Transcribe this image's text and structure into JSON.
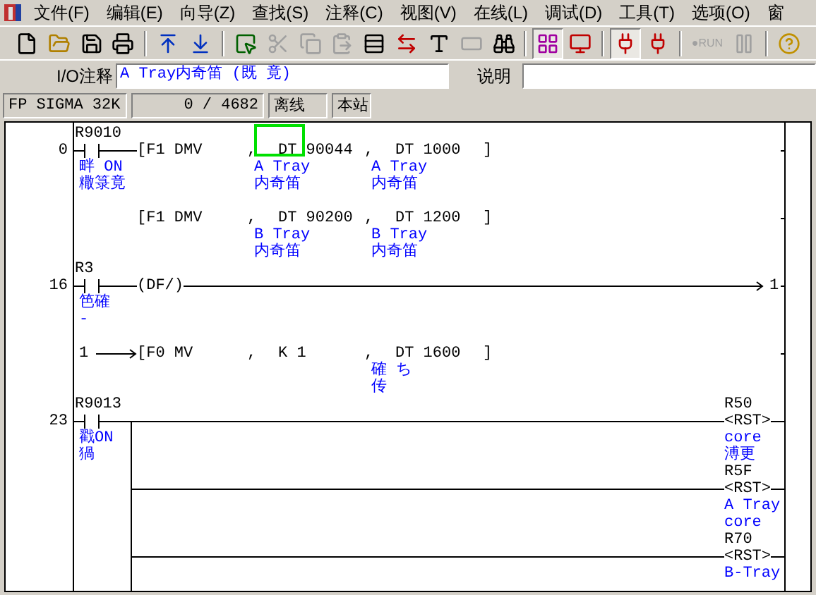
{
  "menu": [
    "文件(F)",
    "编辑(E)",
    "向导(Z)",
    "查找(S)",
    "注释(C)",
    "视图(V)",
    "在线(L)",
    "调试(D)",
    "工具(T)",
    "选项(O)",
    "窗"
  ],
  "toolbar": [
    {
      "kind": "new",
      "disabled": false,
      "pressed": false
    },
    {
      "kind": "open",
      "disabled": false,
      "pressed": false
    },
    {
      "kind": "save",
      "disabled": false,
      "pressed": false
    },
    {
      "kind": "print",
      "disabled": false,
      "pressed": false
    },
    {
      "kind": "separator"
    },
    {
      "kind": "upload",
      "disabled": false,
      "pressed": false
    },
    {
      "kind": "download",
      "disabled": false,
      "pressed": false
    },
    {
      "kind": "separator"
    },
    {
      "kind": "select",
      "disabled": false,
      "pressed": false
    },
    {
      "kind": "cut",
      "disabled": true,
      "pressed": false
    },
    {
      "kind": "copy",
      "disabled": true,
      "pressed": false
    },
    {
      "kind": "paste",
      "disabled": true,
      "pressed": false
    },
    {
      "kind": "grid",
      "disabled": false,
      "pressed": false
    },
    {
      "kind": "swap",
      "disabled": false,
      "pressed": false
    },
    {
      "kind": "text",
      "disabled": false,
      "pressed": false
    },
    {
      "kind": "bar",
      "disabled": true,
      "pressed": false
    },
    {
      "kind": "find",
      "disabled": false,
      "pressed": false
    },
    {
      "kind": "separator"
    },
    {
      "kind": "ladder",
      "disabled": false,
      "pressed": true
    },
    {
      "kind": "monitor",
      "disabled": false,
      "pressed": false
    },
    {
      "kind": "separator"
    },
    {
      "kind": "plug",
      "disabled": false,
      "pressed": true
    },
    {
      "kind": "plug",
      "disabled": false,
      "pressed": false
    },
    {
      "kind": "separator"
    },
    {
      "kind": "run",
      "label": "●RUN",
      "disabled": true,
      "pressed": false
    },
    {
      "kind": "pause",
      "disabled": true,
      "pressed": false
    },
    {
      "kind": "separator"
    },
    {
      "kind": "help",
      "disabled": false,
      "pressed": false
    }
  ],
  "io_comment": {
    "label": "I/O注释",
    "value": "A Tray内奇笛  (既  竟)"
  },
  "description": {
    "label": "说明"
  },
  "status_bar": [
    "FP SIGMA 32K",
    "0 /  4682",
    "离线",
    "本站"
  ],
  "rungs": [
    {
      "kind": "function",
      "step": "0",
      "contact": "R9010",
      "contact_comment": [
        "畔  ON",
        "糤箓竟"
      ],
      "lines": [
        {
          "instruction": "[F1 DMV",
          "operands": [
            {
              "separator": ",",
              "text": "DT 90044",
              "comment": [
                "A Tray",
                "内奇笛"
              ],
              "selected": true
            },
            {
              "separator": ",",
              "text": "DT 1000",
              "comment": [
                "A Tray",
                "内奇笛"
              ],
              "selected": false
            }
          ],
          "close": "]"
        },
        {
          "instruction": "[F1 DMV",
          "operands": [
            {
              "separator": ",",
              "text": "DT 90200",
              "comment": [
                "B Tray",
                "内奇笛"
              ],
              "selected": false
            },
            {
              "separator": ",",
              "text": "DT 1200",
              "comment": [
                "B Tray",
                "内奇笛"
              ],
              "selected": false
            }
          ],
          "close": "]"
        }
      ]
    },
    {
      "kind": "jump",
      "step": "16",
      "contact": "R3",
      "contact_comment": [
        "笆確",
        "-"
      ],
      "output": "(DF/)",
      "target": "1",
      "continuation": {
        "marker": "1",
        "instruction": "[F0 MV",
        "operands": [
          {
            "separator": ",",
            "text": "K 1",
            "selected": false
          },
          {
            "separator": ",",
            "text": "DT 1600",
            "comment": [
              "確  ち",
              "传"
            ],
            "selected": false
          }
        ],
        "close": "]"
      }
    },
    {
      "kind": "reset",
      "step": "23",
      "contact": "R9013",
      "contact_comment": [
        "戳ON",
        "猧"
      ],
      "coils": [
        {
          "label": "R50",
          "instruction": "<RST>",
          "comment": [
            "core",
            "溥更"
          ]
        },
        {
          "label": "R5F",
          "instruction": "<RST>",
          "comment": [
            "A Tray",
            "core"
          ]
        },
        {
          "label": "R70",
          "instruction": "<RST>",
          "comment": [
            "B-Tray"
          ]
        }
      ]
    }
  ]
}
